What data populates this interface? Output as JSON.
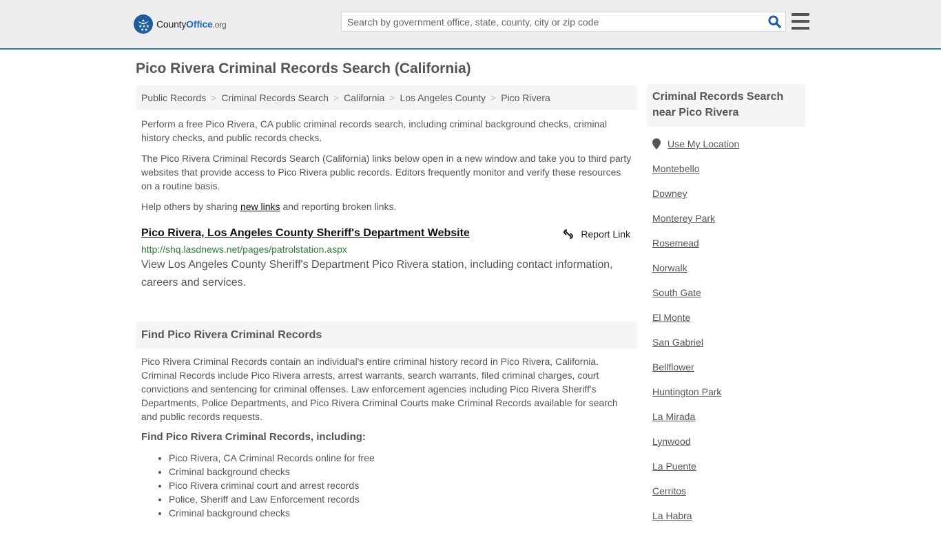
{
  "header": {
    "logo": {
      "word1": "County",
      "word2": "Office",
      "suffix": ".org"
    },
    "search": {
      "placeholder": "Search by government office, state, county, city or zip code",
      "value": ""
    },
    "colors": {
      "accent": "#337ab7",
      "logo_blue": "#1f5c9e"
    }
  },
  "page": {
    "title": "Pico Rivera Criminal Records Search (California)"
  },
  "breadcrumb": [
    {
      "label": "Public Records"
    },
    {
      "label": "Criminal Records Search"
    },
    {
      "label": "California"
    },
    {
      "label": "Los Angeles County"
    },
    {
      "label": "Pico Rivera"
    }
  ],
  "breadcrumb_separator": ">",
  "intro": {
    "p1": "Perform a free Pico Rivera, CA public criminal records search, including criminal background checks, criminal history checks, and public records checks.",
    "p2": "The Pico Rivera Criminal Records Search (California) links below open in a new window and take you to third party websites that provide access to Pico Rivera public records. Editors frequently monitor and verify these resources on a routine basis.",
    "p3_before": "Help others by sharing ",
    "p3_link": "new links",
    "p3_after": " and reporting broken links."
  },
  "results": [
    {
      "title": "Pico Rivera, Los Angeles County Sheriff's Department Website",
      "url": "http://shq.lasdnews.net/pages/patrolstation.aspx",
      "description": "View Los Angeles County Sheriff's Department Pico Rivera station, including contact information, careers and services.",
      "report_label": "Report Link"
    }
  ],
  "find_section": {
    "heading": "Find Pico Rivera Criminal Records",
    "body": "Pico Rivera Criminal Records contain an individual's entire criminal history record in Pico Rivera, California. Criminal Records include Pico Rivera arrests, arrest warrants, search warrants, filed criminal charges, court convictions and sentencing for criminal offenses. Law enforcement agencies including Pico Rivera Sheriff's Departments, Police Departments, and Pico Rivera Criminal Courts make Criminal Records available for search and public records requests.",
    "subheading": "Find Pico Rivera Criminal Records, including:",
    "bullets": [
      "Pico Rivera, CA Criminal Records online for free",
      "Criminal background checks",
      "Pico Rivera criminal court and arrest records",
      "Police, Sheriff and Law Enforcement records",
      "Criminal background checks"
    ]
  },
  "sidebar": {
    "heading": "Criminal Records Search near Pico Rivera",
    "use_location": "Use My Location",
    "nearby": [
      "Montebello",
      "Downey",
      "Monterey Park",
      "Rosemead",
      "Norwalk",
      "South Gate",
      "El Monte",
      "San Gabriel",
      "Bellflower",
      "Huntington Park",
      "La Mirada",
      "Lynwood",
      "La Puente",
      "Cerritos",
      "La Habra"
    ]
  }
}
